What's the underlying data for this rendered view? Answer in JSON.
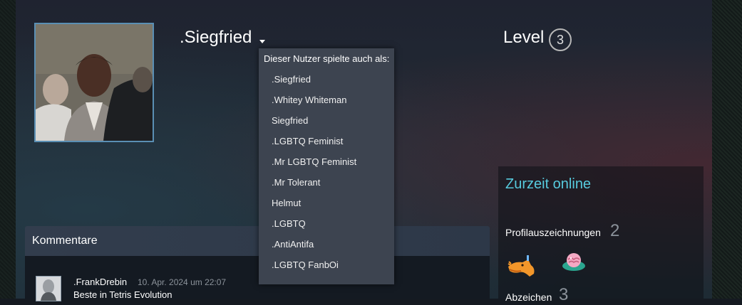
{
  "profile": {
    "persona_name": ".Siegfried",
    "level_label": "Level",
    "level_value": "3"
  },
  "alias_dropdown": {
    "header": "Dieser Nutzer spielte auch als:",
    "aliases": [
      ".Siegfried",
      ".Whitey Whiteman",
      "Siegfried",
      ".LGBTQ Feminist",
      ".Mr LGBTQ Feminist",
      ".Mr Tolerant",
      "Helmut",
      ".LGBTQ",
      ".AntiAntifa",
      ".LGBTQ FanbOi"
    ]
  },
  "comments": {
    "title": "Kommentare",
    "items": [
      {
        "author": ".FrankDrebin",
        "date": "10. Apr. 2024 um 22:07",
        "text": "Beste in Tetris Evolution"
      }
    ]
  },
  "sidebar": {
    "status": "Zurzeit online",
    "awards_label": "Profilauszeichnungen",
    "awards_count": "2",
    "badges_label": "Abzeichen",
    "badges_count": "3"
  },
  "colors": {
    "online_accent": "#57cbde",
    "dropdown_bg": "#3d4450",
    "avatar_border": "#5a8fb4"
  },
  "icons": {
    "caret": "caret-down-icon",
    "award_1": "orange-dragon-award-icon",
    "award_2": "pink-brain-award-icon"
  }
}
